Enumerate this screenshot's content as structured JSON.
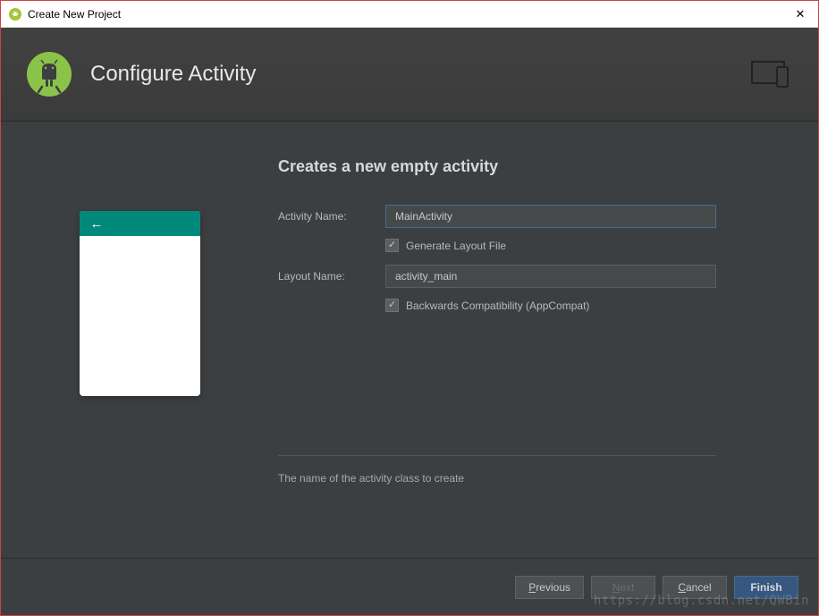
{
  "window": {
    "title": "Create New Project"
  },
  "header": {
    "title": "Configure Activity"
  },
  "form": {
    "heading": "Creates a new empty activity",
    "activity_name_label": "Activity Name:",
    "activity_name_value": "MainActivity",
    "generate_layout_label": "Generate Layout File",
    "generate_layout_checked": true,
    "layout_name_label": "Layout Name:",
    "layout_name_value": "activity_main",
    "backwards_compat_label": "Backwards Compatibility (AppCompat)",
    "backwards_compat_checked": true
  },
  "help": {
    "text": "The name of the activity class to create"
  },
  "buttons": {
    "previous": "Previous",
    "next": "Next",
    "cancel": "Cancel",
    "finish": "Finish"
  },
  "watermark": "https://blog.csdn.net/QWBin"
}
